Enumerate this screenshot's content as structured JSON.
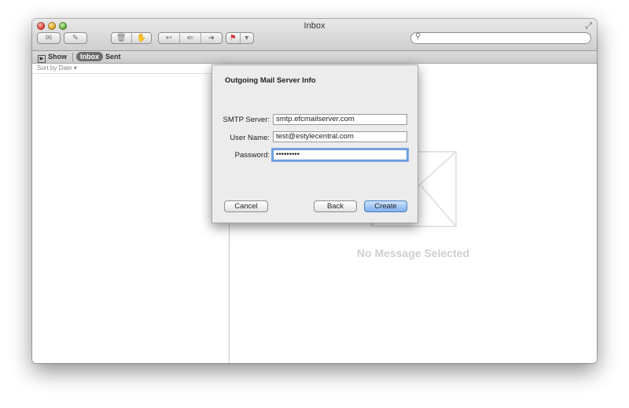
{
  "window": {
    "title": "Inbox"
  },
  "toolbar": {
    "buttons": [
      {
        "icon": "envelope-icon"
      },
      {
        "icon": "compose-icon"
      },
      {
        "icon": "trash-icon"
      },
      {
        "icon": "junk-icon"
      },
      {
        "icon": "reply-icon"
      },
      {
        "icon": "reply-all-icon"
      },
      {
        "icon": "forward-icon"
      },
      {
        "icon": "flag-icon"
      }
    ],
    "search": {
      "placeholder": ""
    }
  },
  "favorites": {
    "show_label": "Show",
    "inbox_label": "Inbox",
    "sent_label": "Sent"
  },
  "message_list": {
    "sort_label": "Sort by Date ▾"
  },
  "viewer": {
    "empty_text": "No Message Selected"
  },
  "dialog": {
    "title": "Outgoing Mail Server Info",
    "fields": {
      "smtp_label": "SMTP Server:",
      "smtp_value": "smtp.efcmailserver.com",
      "user_label": "User Name:",
      "user_value": "test@estylecentral.com",
      "password_label": "Password:",
      "password_value": "•••••••••"
    },
    "cancel_label": "Cancel",
    "back_label": "Back",
    "create_label": "Create"
  },
  "colors": {
    "default_button": "#7fb0ef",
    "focus_ring": "#7aa7e0"
  }
}
